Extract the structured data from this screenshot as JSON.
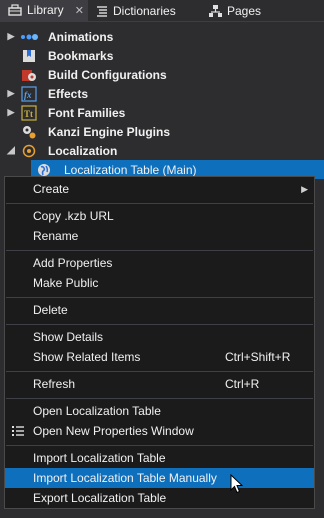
{
  "tabs": [
    {
      "label": "Library",
      "icon": "library-icon",
      "active": true,
      "close": "✕"
    },
    {
      "label": "Dictionaries",
      "icon": "dictionary-icon",
      "active": false
    },
    {
      "label": "Pages",
      "icon": "pages-icon",
      "active": false
    }
  ],
  "tree": [
    {
      "label": "Animations",
      "icon": "animations-icon",
      "expandable": true
    },
    {
      "label": "Bookmarks",
      "icon": "bookmarks-icon",
      "expandable": false
    },
    {
      "label": "Build Configurations",
      "icon": "build-config-icon",
      "expandable": false
    },
    {
      "label": "Effects",
      "icon": "effects-icon",
      "expandable": true
    },
    {
      "label": "Font Families",
      "icon": "font-icon",
      "expandable": true
    },
    {
      "label": "Kanzi Engine Plugins",
      "icon": "plugins-icon",
      "expandable": false
    },
    {
      "label": "Localization",
      "icon": "localization-icon",
      "expandable": true,
      "expanded": true
    },
    {
      "label": "Localization Table (Main)",
      "icon": "globe-icon",
      "selected": true
    }
  ],
  "menu": {
    "groups": [
      [
        {
          "label": "Create",
          "submenu": true
        }
      ],
      [
        {
          "label": "Copy .kzb URL"
        },
        {
          "label": "Rename"
        }
      ],
      [
        {
          "label": "Add Properties"
        },
        {
          "label": "Make Public"
        }
      ],
      [
        {
          "label": "Delete"
        }
      ],
      [
        {
          "label": "Show Details"
        },
        {
          "label": "Show Related Items",
          "shortcut": "Ctrl+Shift+R"
        }
      ],
      [
        {
          "label": "Refresh",
          "shortcut": "Ctrl+R"
        }
      ],
      [
        {
          "label": "Open Localization Table"
        },
        {
          "label": "Open New Properties Window",
          "icon": "properties-list-icon"
        }
      ],
      [
        {
          "label": "Import Localization Table"
        },
        {
          "label": "Import Localization Table Manually",
          "highlighted": true
        },
        {
          "label": "Export Localization Table"
        }
      ]
    ]
  },
  "colors": {
    "background": "#2d2d30",
    "selection": "#0e6fbd",
    "menu_background": "#1b1b1c"
  }
}
